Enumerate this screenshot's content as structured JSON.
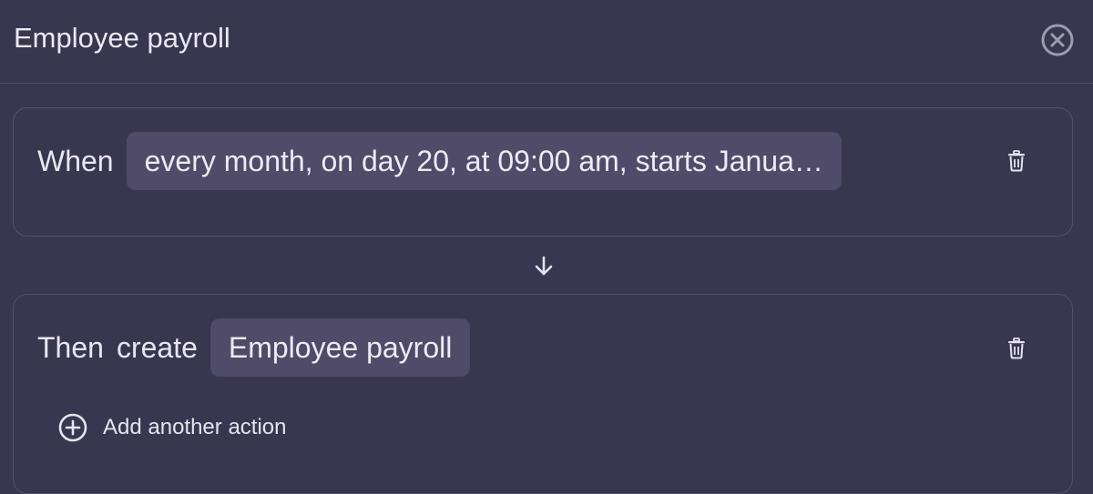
{
  "header": {
    "title": "Employee payroll",
    "close_icon": "close-circle-icon"
  },
  "trigger": {
    "label": "When",
    "schedule": "every month, on day 20, at 09:00 am, starts Janua…",
    "delete_icon": "trash-icon"
  },
  "connector": {
    "icon": "arrow-down-icon"
  },
  "action": {
    "label_then": "Then",
    "label_create": "create",
    "target": "Employee payroll",
    "delete_icon": "trash-icon",
    "add_action_label": "Add another action",
    "add_icon": "plus-circle-icon"
  },
  "colors": {
    "background": "#393650",
    "chip": "#4f4b68",
    "border": "#534f6d",
    "text": "#e9e7f2"
  }
}
